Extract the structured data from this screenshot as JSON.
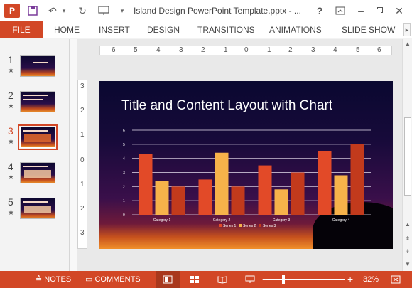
{
  "titlebar": {
    "logo_text": "P",
    "document_title": "Island Design PowerPoint Template.pptx - ...",
    "help_label": "?",
    "icons": [
      "save-icon",
      "undo-icon",
      "redo-icon",
      "present-icon",
      "customize-icon"
    ]
  },
  "ribbon": {
    "tabs": [
      "FILE",
      "HOME",
      "INSERT",
      "DESIGN",
      "TRANSITIONS",
      "ANIMATIONS",
      "SLIDE SHOW"
    ]
  },
  "thumbnails": [
    {
      "number": "1",
      "star": "★"
    },
    {
      "number": "2",
      "star": "★"
    },
    {
      "number": "3",
      "star": "★"
    },
    {
      "number": "4",
      "star": "★"
    },
    {
      "number": "5",
      "star": "★"
    }
  ],
  "rulers": {
    "horizontal": [
      "6",
      "5",
      "4",
      "3",
      "2",
      "1",
      "0",
      "1",
      "2",
      "3",
      "4",
      "5",
      "6"
    ],
    "vertical": [
      "3",
      "2",
      "1",
      "0",
      "1",
      "2",
      "3"
    ]
  },
  "slide": {
    "title": "Title and Content Layout with Chart"
  },
  "chart_data": {
    "type": "bar",
    "categories": [
      "Category 1",
      "Category 2",
      "Category 3",
      "Category 4"
    ],
    "series": [
      {
        "name": "Series 1",
        "values": [
          4.3,
          2.5,
          3.5,
          4.5
        ],
        "color": "#e24a28"
      },
      {
        "name": "Series 2",
        "values": [
          2.4,
          4.4,
          1.8,
          2.8
        ],
        "color": "#f6b24a"
      },
      {
        "name": "Series 3",
        "values": [
          2.0,
          2.0,
          3.0,
          5.0
        ],
        "color": "#c23a1c"
      }
    ],
    "ylim": [
      0,
      6
    ],
    "yticks": [
      "0",
      "1",
      "2",
      "3",
      "4",
      "5",
      "6"
    ],
    "grid": true,
    "legend": "bottom"
  },
  "statusbar": {
    "notes_label": "NOTES",
    "comments_label": "COMMENTS",
    "zoom_minus": "−",
    "zoom_plus": "+",
    "zoom_level": "32%"
  },
  "colors": {
    "accent": "#d24726"
  }
}
